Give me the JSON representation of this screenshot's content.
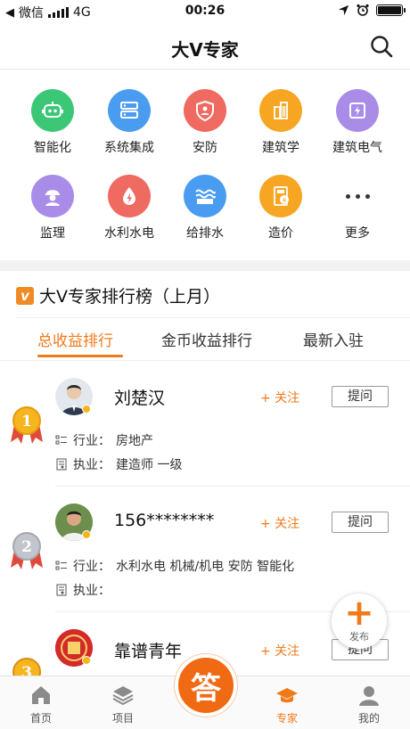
{
  "status_bar": {
    "back_app": "微信",
    "network": "4G",
    "time": "00:26"
  },
  "nav": {
    "title": "大V专家"
  },
  "categories": [
    {
      "label": "智能化",
      "icon": "robot-icon",
      "color": "#3cc777"
    },
    {
      "label": "系统集成",
      "icon": "server-icon",
      "color": "#4a9cf0"
    },
    {
      "label": "安防",
      "icon": "shield-icon",
      "color": "#ef6a60"
    },
    {
      "label": "建筑学",
      "icon": "building-icon",
      "color": "#f6a623"
    },
    {
      "label": "建筑电气",
      "icon": "electric-icon",
      "color": "#a98ce8"
    },
    {
      "label": "监理",
      "icon": "supervisor-icon",
      "color": "#a98ce8"
    },
    {
      "label": "水利水电",
      "icon": "water-power-icon",
      "color": "#ef6a60"
    },
    {
      "label": "给排水",
      "icon": "water-waves-icon",
      "color": "#4a9cf0"
    },
    {
      "label": "造价",
      "icon": "cost-icon",
      "color": "#f6a623"
    },
    {
      "label": "更多",
      "icon": "more-icon",
      "color": "#333333"
    }
  ],
  "ranking": {
    "badge": "v",
    "title": "大V专家排行榜（上月）",
    "tabs": [
      "总收益排行",
      "金币收益排行",
      "最新入驻"
    ],
    "active_tab": 0
  },
  "experts": [
    {
      "rank": "1",
      "name": "刘楚汉",
      "follow": "+ 关注",
      "ask": "提问",
      "industry_label": "行业：",
      "industry": "房地产",
      "practice_label": "执业：",
      "practice": "建造师 一级"
    },
    {
      "rank": "2",
      "name": "156********",
      "follow": "+ 关注",
      "ask": "提问",
      "industry_label": "行业：",
      "industry": "水利水电 机械/机电 安防 智能化",
      "practice_label": "执业：",
      "practice": ""
    },
    {
      "rank": "3",
      "name": "靠谱青年",
      "follow": "+ 关注",
      "ask": "提问"
    }
  ],
  "fab": {
    "label": "发布"
  },
  "tabbar": {
    "items": [
      "首页",
      "项目",
      "专家",
      "我的"
    ],
    "answer": "答",
    "active": 2
  },
  "colors": {
    "accent": "#f07a1a",
    "gold": "#f6b51e",
    "silver": "#b8bcc4"
  }
}
